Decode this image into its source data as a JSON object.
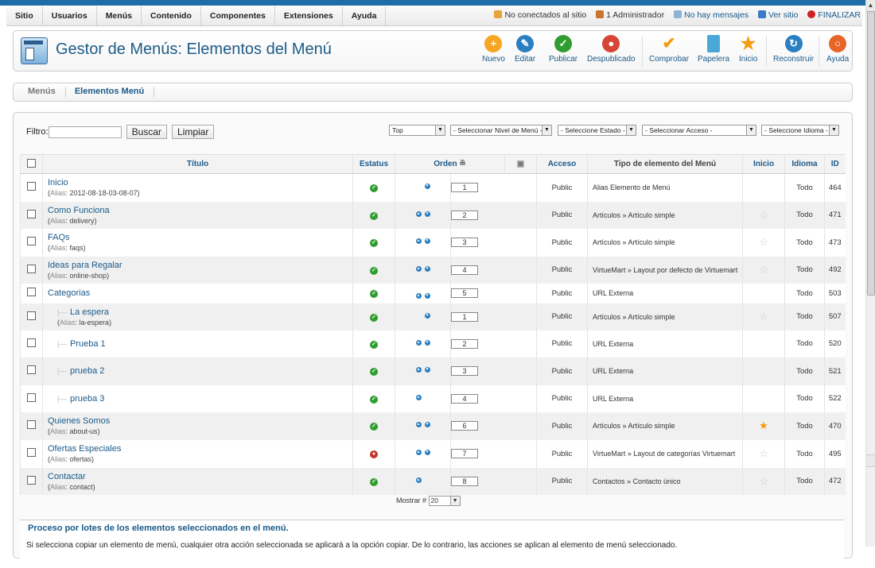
{
  "menu": [
    "Sitio",
    "Usuarios",
    "Menús",
    "Contenido",
    "Componentes",
    "Extensiones",
    "Ayuda"
  ],
  "status": {
    "online": "No conectados al sitio",
    "admin": "1 Administrador",
    "messages": "No hay mensajes",
    "view": "Ver sitio",
    "logout": "FINALIZAR"
  },
  "page_title": "Gestor de Menús: Elementos del Menú",
  "toolbar": {
    "new": "Nuevo",
    "edit": "Editar",
    "publish": "Publicar",
    "unpublish": "Despublicado",
    "check": "Comprobar",
    "trash": "Papelera",
    "home": "Inicio",
    "rebuild": "Reconstruir",
    "help": "Ayuda"
  },
  "tabs": [
    "Menús",
    "Elementos Menú"
  ],
  "filter": {
    "label": "Filtro:",
    "search": "Buscar",
    "clear": "Limpiar",
    "menu": "Top",
    "level": "- Seleccionar Nivel de Menú -",
    "state": "- Seleccione Estado -",
    "access": "- Seleccionar Acceso -",
    "lang": "- Seleccione Idioma -"
  },
  "columns": {
    "title": "Título",
    "status": "Estatus",
    "order": "Orden",
    "access": "Acceso",
    "type": "Tipo de elemento del Menú",
    "home": "Inicio",
    "lang": "Idioma",
    "id": "ID"
  },
  "alias_label": "Alias",
  "rows": [
    {
      "title": "Inicio",
      "alias": "2012-08-18-03-08-07",
      "up": false,
      "down": true,
      "order": "1",
      "access": "Public",
      "type": "Alias Elemento de Menú",
      "home": "",
      "lang": "Todo",
      "id": "464",
      "published": true,
      "level": 0
    },
    {
      "title": "Como Funciona",
      "alias": "delivery",
      "up": true,
      "down": true,
      "order": "2",
      "access": "Public",
      "type": "Artículos » Artículo simple",
      "home": "off",
      "lang": "Todo",
      "id": "471",
      "published": true,
      "level": 0
    },
    {
      "title": "FAQs",
      "alias": "faqs",
      "up": true,
      "down": true,
      "order": "3",
      "access": "Public",
      "type": "Artículos » Artículo simple",
      "home": "off",
      "lang": "Todo",
      "id": "473",
      "published": true,
      "level": 0
    },
    {
      "title": "Ideas para Regalar",
      "alias": "online-shop",
      "up": true,
      "down": true,
      "order": "4",
      "access": "Public",
      "type": "VirtueMart » Layout por defecto de Virtuemart",
      "home": "off",
      "lang": "Todo",
      "id": "492",
      "published": true,
      "level": 0
    },
    {
      "title": "Categorias",
      "alias": "",
      "up": true,
      "down": true,
      "order": "5",
      "access": "Public",
      "type": "URL Externa",
      "home": "",
      "lang": "Todo",
      "id": "503",
      "published": true,
      "level": 0
    },
    {
      "title": "La espera",
      "alias": "la-espera",
      "up": false,
      "down": true,
      "order": "1",
      "access": "Public",
      "type": "Artículos » Artículo simple",
      "home": "off",
      "lang": "Todo",
      "id": "507",
      "published": true,
      "level": 1
    },
    {
      "title": "Prueba 1",
      "alias": "",
      "up": true,
      "down": true,
      "order": "2",
      "access": "Public",
      "type": "URL Externa",
      "home": "",
      "lang": "Todo",
      "id": "520",
      "published": true,
      "level": 1
    },
    {
      "title": "prueba 2",
      "alias": "",
      "up": true,
      "down": true,
      "order": "3",
      "access": "Public",
      "type": "URL Externa",
      "home": "",
      "lang": "Todo",
      "id": "521",
      "published": true,
      "level": 1
    },
    {
      "title": "prueba 3",
      "alias": "",
      "up": true,
      "down": false,
      "order": "4",
      "access": "Public",
      "type": "URL Externa",
      "home": "",
      "lang": "Todo",
      "id": "522",
      "published": true,
      "level": 1
    },
    {
      "title": "Quienes Somos",
      "alias": "about-us",
      "up": true,
      "down": true,
      "order": "6",
      "access": "Public",
      "type": "Artículos » Artículo simple",
      "home": "on",
      "lang": "Todo",
      "id": "470",
      "published": true,
      "level": 0
    },
    {
      "title": "Ofertas Especiales",
      "alias": "ofertas",
      "up": true,
      "down": true,
      "order": "7",
      "access": "Public",
      "type": "VirtueMart » Layout de categorías Virtuemart",
      "home": "off",
      "lang": "Todo",
      "id": "495",
      "published": false,
      "level": 0
    },
    {
      "title": "Contactar",
      "alias": "contact",
      "up": true,
      "down": false,
      "order": "8",
      "access": "Public",
      "type": "Contactos » Contacto único",
      "home": "off",
      "lang": "Todo",
      "id": "472",
      "published": true,
      "level": 0
    }
  ],
  "pager": {
    "label": "Mostrar #",
    "value": "20"
  },
  "batch": {
    "title": "Proceso por lotes de los elementos seleccionados en el menú.",
    "desc": "Si selecciona copiar un elemento de menú, cualquier otra acción seleccionada se aplicará a la opción copiar. De lo contrario, las acciones se aplican al elemento de menú seleccionado."
  }
}
